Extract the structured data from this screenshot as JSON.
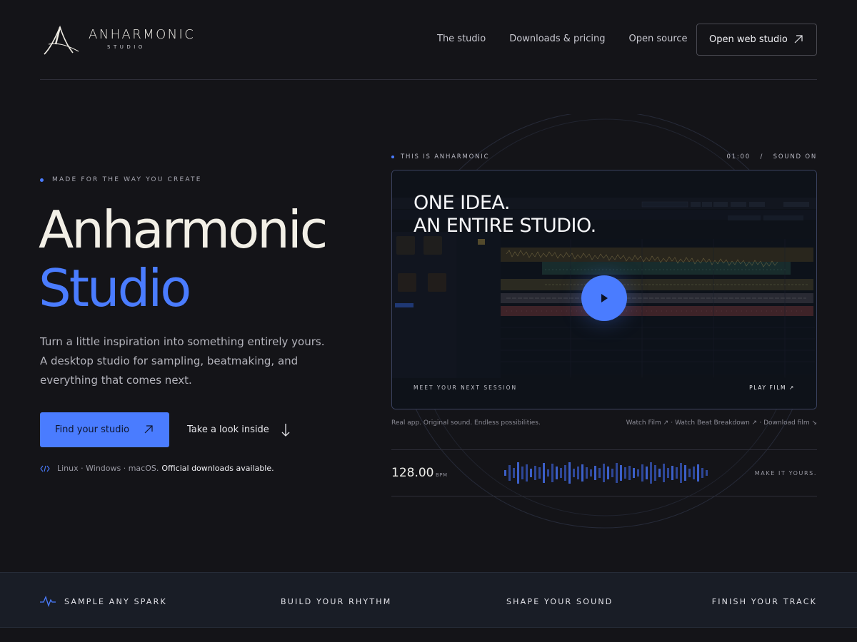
{
  "brand": {
    "name": "ANHARMONIC",
    "sub": "STUDIO"
  },
  "nav": [
    {
      "label": "The studio"
    },
    {
      "label": "Downloads & pricing"
    },
    {
      "label": "Open source"
    }
  ],
  "header_cta": {
    "label": "Open web studio",
    "icon": "arrow-up-right-icon"
  },
  "hero": {
    "eyebrow": "MADE FOR THE WAY YOU CREATE",
    "title_line1": "Anharmonic",
    "title_line2": "Studio",
    "lede": "Turn a little inspiration into something entirely yours. A desktop studio for sampling, beatmaking, and everything that comes next.",
    "primary_cta": "Find your studio",
    "secondary_cta": "Take a look inside",
    "platforms": "Linux · Windows · macOS.",
    "platforms_note": "Official downloads available."
  },
  "film": {
    "eyebrow": "THIS IS ANHARMONIC",
    "meta": "01:00   /   SOUND ON",
    "headline_line1": "ONE IDEA.",
    "headline_line2": "AN ENTIRE STUDIO.",
    "foot_left": "MEET YOUR NEXT SESSION",
    "foot_right": "PLAY FILM ↗",
    "caption": "Real app. Original sound. Endless possibilities.",
    "links": [
      "Watch Film ↗",
      "Watch Beat Breakdown ↗",
      "Download film ↘"
    ]
  },
  "tempo": {
    "value": "128.00",
    "unit": "BPM",
    "tagline": "MAKE IT YOURS."
  },
  "features": [
    {
      "label": "SAMPLE ANY SPARK",
      "icon": "pulse-icon"
    },
    {
      "label": "BUILD YOUR RHYTHM"
    },
    {
      "label": "SHAPE YOUR SOUND"
    },
    {
      "label": "FINISH YOUR TRACK"
    }
  ],
  "colors": {
    "accent": "#4a7cff",
    "background": "#141418",
    "band": "#191d26"
  }
}
